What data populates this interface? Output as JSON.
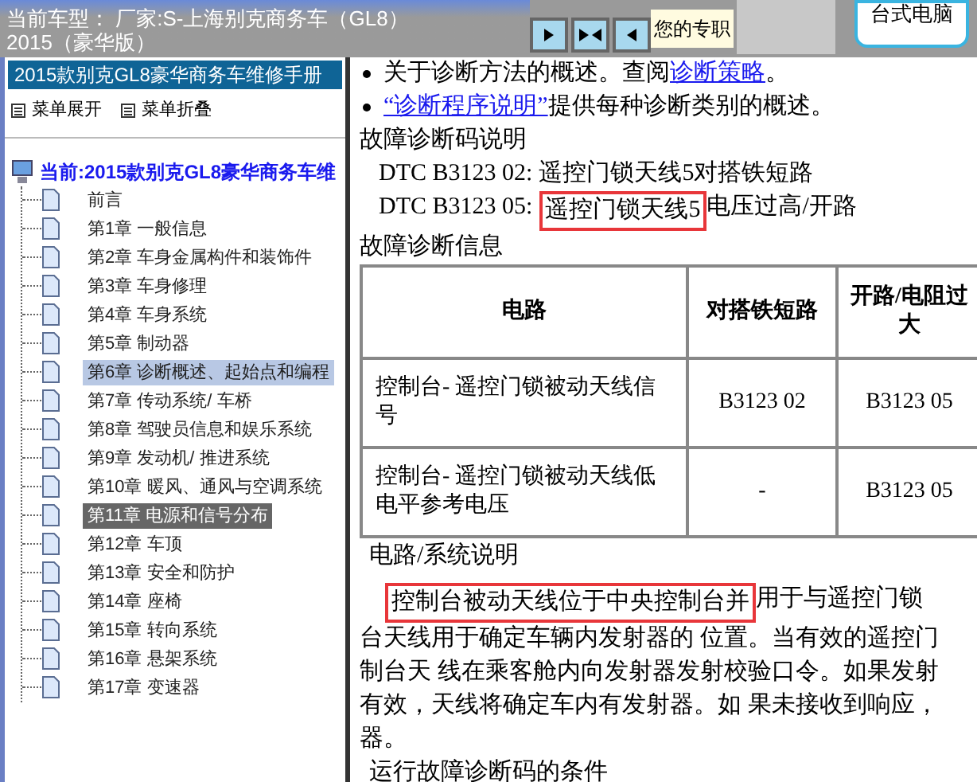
{
  "header": {
    "title_lines": [
      "当前车型： 厂家:S-上海别克商务车（GL8）",
      "2015（豪华版）"
    ],
    "nav_buttons": [
      {
        "kind": "forward"
      },
      {
        "kind": "both"
      },
      {
        "kind": "back"
      }
    ],
    "notice": "您的专职",
    "promo": "台式电脑"
  },
  "sidebar": {
    "title": "2015款别克GL8豪华商务车维修手册",
    "menu": [
      "菜单展开",
      "菜单折叠"
    ],
    "tree": {
      "label": "当前:2015款别克GL8豪华商务车维",
      "children": [
        {
          "label": "前言",
          "selected": false,
          "hovered": false
        },
        {
          "label": "第1章 一般信息",
          "selected": false,
          "hovered": false
        },
        {
          "label": "第2章 车身金属构件和装饰件",
          "selected": false,
          "hovered": false
        },
        {
          "label": "第3章 车身修理",
          "selected": false,
          "hovered": false
        },
        {
          "label": "第4章 车身系统",
          "selected": false,
          "hovered": false
        },
        {
          "label": "第5章 制动器",
          "selected": false,
          "hovered": false
        },
        {
          "label": "第6章 诊断概述、起始点和编程",
          "selected": false,
          "hovered": true
        },
        {
          "label": "第7章 传动系统/ 车桥",
          "selected": false,
          "hovered": false
        },
        {
          "label": "第8章 驾驶员信息和娱乐系统",
          "selected": false,
          "hovered": false
        },
        {
          "label": "第9章 发动机/ 推进系统",
          "selected": false,
          "hovered": false
        },
        {
          "label": "第10章 暖风、通风与空调系统",
          "selected": false,
          "hovered": false
        },
        {
          "label": "第11章 电源和信号分布",
          "selected": true,
          "hovered": false
        },
        {
          "label": "第12章 车顶",
          "selected": false,
          "hovered": false
        },
        {
          "label": "第13章 安全和防护",
          "selected": false,
          "hovered": false
        },
        {
          "label": "第14章 座椅",
          "selected": false,
          "hovered": false
        },
        {
          "label": "第15章 转向系统",
          "selected": false,
          "hovered": false
        },
        {
          "label": "第16章 悬架系统",
          "selected": false,
          "hovered": false
        },
        {
          "label": "第17章 变速器",
          "selected": false,
          "hovered": false
        }
      ]
    }
  },
  "content": {
    "bullets": [
      {
        "text": "关于诊断方法的概述。查阅",
        "link": "诊断策略",
        "after": "。"
      },
      {
        "link": "“诊断程序说明”",
        "after": "提供每种诊断类别的概述。"
      }
    ],
    "dtc_heading": "故障诊断码说明",
    "dtcs": [
      {
        "code": "DTC B3123 02:",
        "parts": [
          {
            "text": "遥控门锁天线5对搭铁短路",
            "highlighted": false
          }
        ]
      },
      {
        "code": "DTC B3123 05:",
        "parts": [
          {
            "text": "遥控门锁天线5",
            "highlighted": true
          },
          {
            "text": "电压过高/开路",
            "highlighted": false
          }
        ]
      }
    ],
    "info_heading": "故障诊断信息",
    "table": {
      "columns": [
        "电路",
        "对搭铁短路",
        "开路/电阻过大"
      ],
      "rows": [
        [
          "控制台- 遥控门锁被动天线信号",
          "B3123 02",
          "B3123 05"
        ],
        [
          "控制台- 遥控门锁被动天线低电平参考电压",
          "-",
          "B3123 05"
        ]
      ]
    },
    "system_heading": "电路/系统说明",
    "paragraph": [
      {
        "parts": [
          {
            "text": "控制台被动天线位于中央控制台并",
            "highlighted": true
          },
          {
            "text": "用于与遥控门锁",
            "highlighted": false
          }
        ]
      },
      {
        "parts": [
          {
            "text": "台天线用于确定车辆内发射器的 位置。当有效的遥控门",
            "highlighted": false
          }
        ]
      },
      {
        "parts": [
          {
            "text": "制台天 线在乘客舱内向发射器发射校验口令。如果发射",
            "highlighted": false
          }
        ]
      },
      {
        "parts": [
          {
            "text": "有效，天线将确定车内有发射器。如 果未接收到响应，",
            "highlighted": false
          }
        ]
      },
      {
        "parts": [
          {
            "text": "器。",
            "highlighted": false
          }
        ]
      }
    ],
    "conditions_heading": "运行故障诊断码的条件"
  }
}
